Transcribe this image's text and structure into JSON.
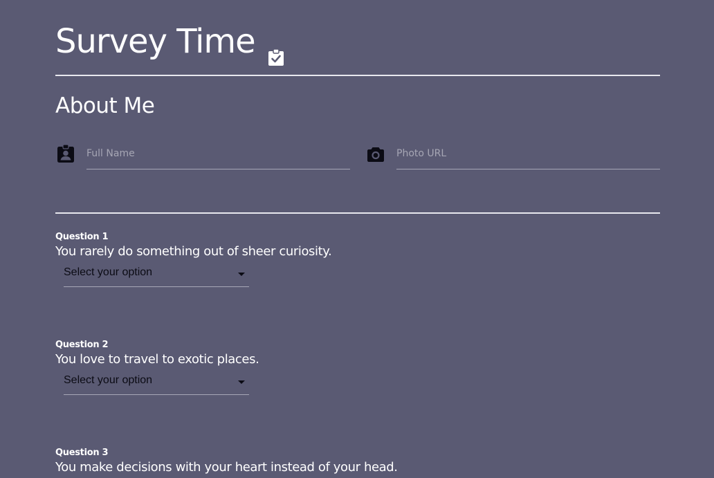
{
  "header": {
    "title": "Survey Time",
    "title_icon": "clipboard-check-icon"
  },
  "about": {
    "heading": "About Me",
    "full_name": {
      "icon": "badge-person-icon",
      "placeholder": "Full Name",
      "value": ""
    },
    "photo_url": {
      "icon": "camera-icon",
      "placeholder": "Photo URL",
      "value": ""
    }
  },
  "questions": [
    {
      "label": "Question 1",
      "text": "You rarely do something out of sheer curiosity.",
      "selected": "Select your option"
    },
    {
      "label": "Question 2",
      "text": "You love to travel to exotic places.",
      "selected": "Select your option"
    },
    {
      "label": "Question 3",
      "text": "You make decisions with your heart instead of your head."
    }
  ],
  "colors": {
    "background": "#5a5a73",
    "text": "#ffffff",
    "select_text": "#0b0b14",
    "icon": "#0b0b14"
  }
}
